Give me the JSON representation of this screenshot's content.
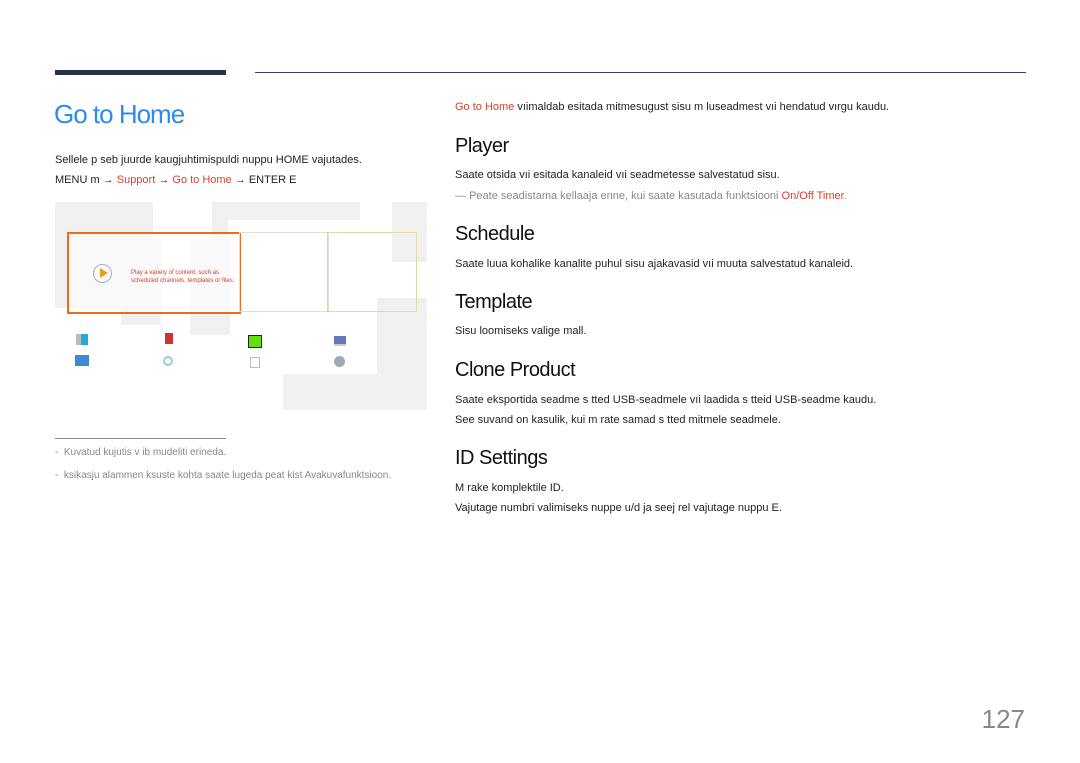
{
  "header": {
    "title": "Go to Home"
  },
  "left": {
    "intro": "Sellele p  seb juurde kaugjuhtimispuldi nuppu HOME vajutades.",
    "path": {
      "menu": "MENU m",
      "arrow": "→",
      "support": "Support",
      "go_home": "Go to Home",
      "enter": "ENTER E"
    },
    "screenshot": {
      "tile_desc_line1": "Play a variety of content, such as",
      "tile_desc_line2": "scheduled channels, templates or files.",
      "play_icon": "play-icon"
    },
    "notes": [
      "Kuvatud kujutis v ib mudeliti erineda.",
      "ksikasju alammen   ksuste kohta saate lugeda peat kist  Avakuvafunktsioon."
    ]
  },
  "right": {
    "intro_link": "Go to Home",
    "intro_rest": " vıimaldab esitada mitmesugust sisu m luseadmest vıi  hendatud vırgu kaudu.",
    "sections": [
      {
        "heading": "Player",
        "lines": [
          "Saate otsida vıi esitada kanaleid vıi seadmetesse salvestatud sisu."
        ],
        "note": "Peate seadistama kellaaja enne, kui saate kasutada funktsiooni ",
        "note_link": "On/Off Timer",
        "note_end": "."
      },
      {
        "heading": "Schedule",
        "lines": [
          "Saate luua kohalike kanalite puhul sisu ajakavasid vıi muuta salvestatud kanaleid."
        ]
      },
      {
        "heading": "Template",
        "lines": [
          "Sisu loomiseks valige mall."
        ]
      },
      {
        "heading": "Clone Product",
        "lines": [
          "Saate eksportida seadme s tted USB-seadmele vıi laadida s tteid USB-seadme kaudu.",
          "See suvand on kasulik, kui m  rate samad s tted mitmele seadmele."
        ]
      },
      {
        "heading": "ID Settings",
        "lines": [
          "M  rake komplektile ID.",
          "Vajutage numbri valimiseks nuppe u/d ja seej rel vajutage nuppu E."
        ]
      }
    ]
  },
  "page_number": "127",
  "colors": {
    "title": "#2b8de8",
    "link": "#d9402a",
    "highlight": "#f06a1a"
  }
}
